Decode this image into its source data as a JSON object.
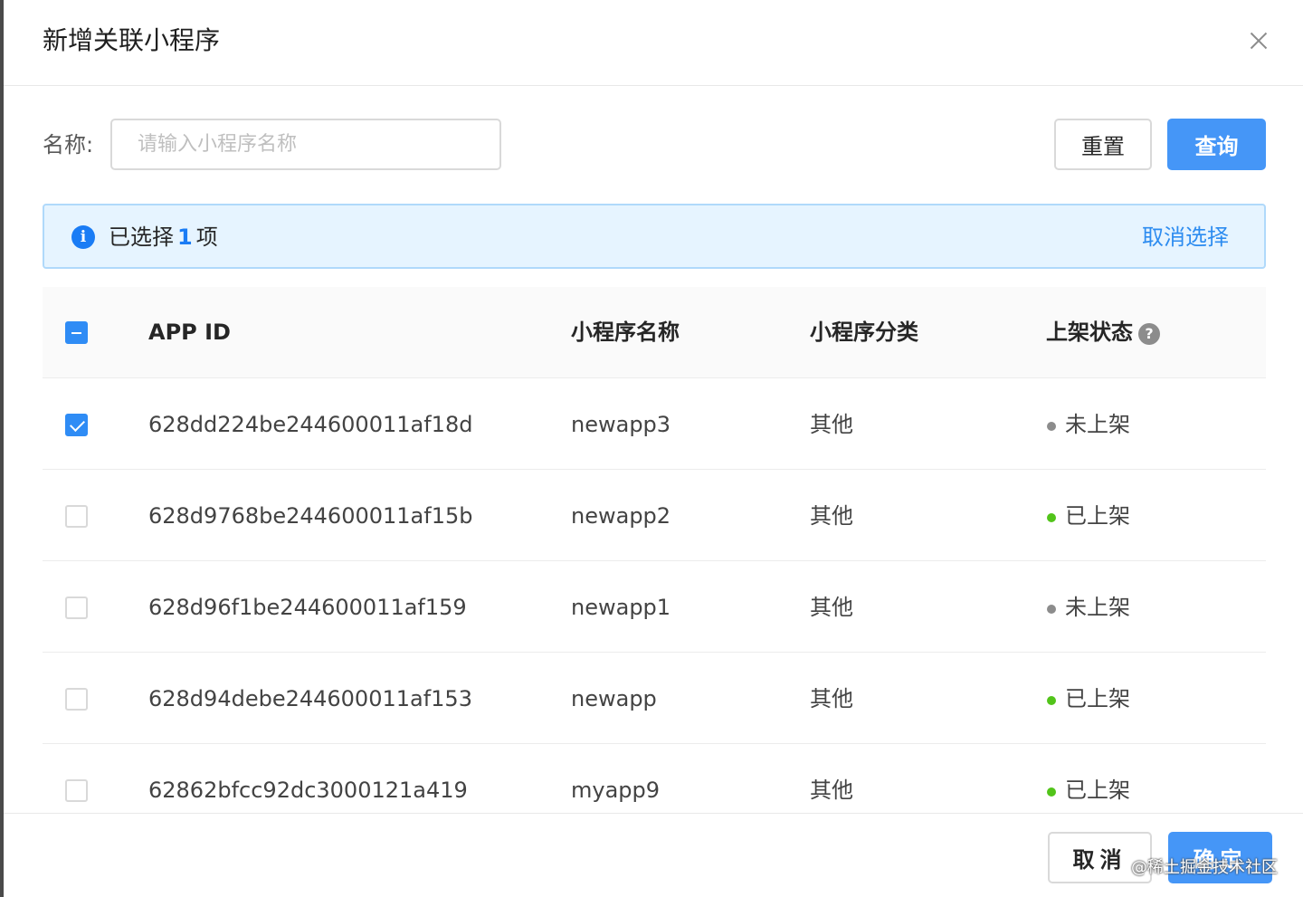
{
  "modal": {
    "title": "新增关联小程序",
    "close_icon": "close-icon"
  },
  "search": {
    "label": "名称:",
    "placeholder": "请输入小程序名称",
    "value": "",
    "reset_label": "重置",
    "query_label": "查询"
  },
  "selection": {
    "icon": "info-icon",
    "prefix": "已选择",
    "count": "1",
    "suffix": "项",
    "clear_label": "取消选择"
  },
  "table": {
    "columns": {
      "app_id": "APP ID",
      "name": "小程序名称",
      "category": "小程序分类",
      "status": "上架状态"
    },
    "rows": [
      {
        "app_id": "628dd224be244600011af18d",
        "name": "newapp3",
        "category": "其他",
        "status": "未上架",
        "checked": true
      },
      {
        "app_id": "628d9768be244600011af15b",
        "name": "newapp2",
        "category": "其他",
        "status": "已上架",
        "checked": false
      },
      {
        "app_id": "628d96f1be244600011af159",
        "name": "newapp1",
        "category": "其他",
        "status": "未上架",
        "checked": false
      },
      {
        "app_id": "628d94debe244600011af153",
        "name": "newapp",
        "category": "其他",
        "status": "已上架",
        "checked": false
      },
      {
        "app_id": "62862bfcc92dc3000121a419",
        "name": "myapp9",
        "category": "其他",
        "status": "已上架",
        "checked": false
      }
    ]
  },
  "footer": {
    "cancel_label": "取消",
    "ok_label": "确定"
  },
  "watermark": "@稀土掘金技术社区",
  "colors": {
    "primary": "#4596f7",
    "published": "#52c41a",
    "unpublished": "#8c8c8c"
  }
}
